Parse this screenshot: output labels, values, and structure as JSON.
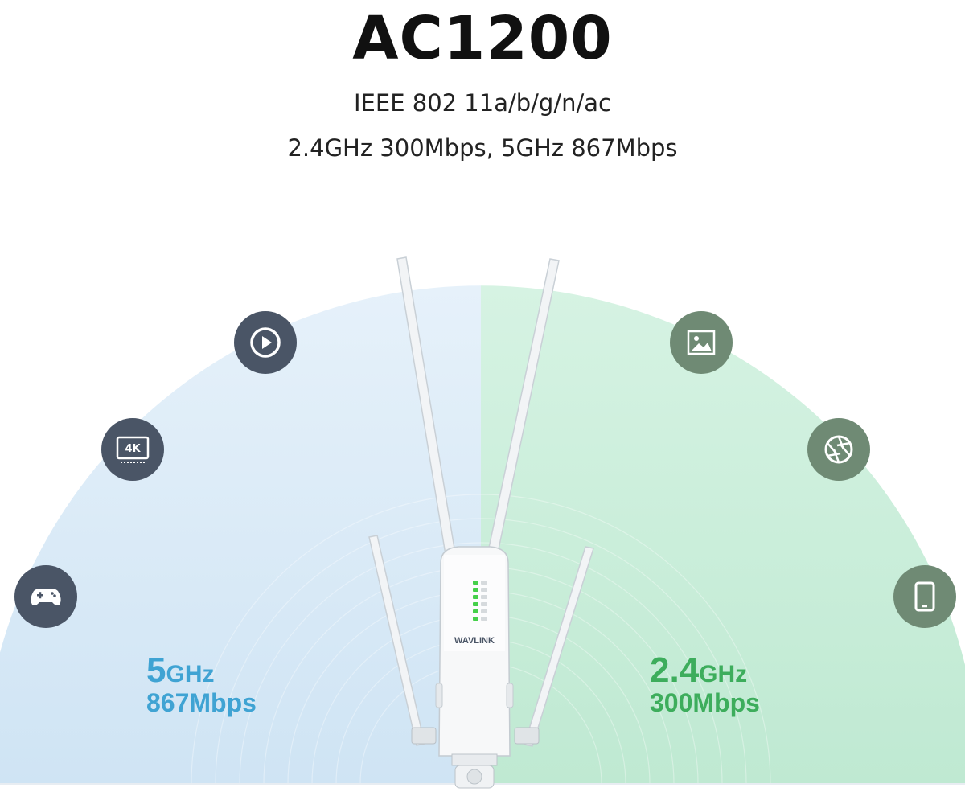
{
  "header": {
    "title": "AC1200",
    "subtitle_line1": "IEEE 802 11a/b/g/n/ac",
    "subtitle_line2": "2.4GHz 300Mbps, 5GHz 867Mbps"
  },
  "device": {
    "brand_label": "WAVLINK"
  },
  "bands": {
    "left": {
      "freq_number": "5",
      "freq_unit": "GHz",
      "rate": "867Mbps",
      "color": "#3fa3d3"
    },
    "right": {
      "freq_number": "2.4",
      "freq_unit": "GHz",
      "rate": "300Mbps",
      "color": "#3dad5c"
    }
  },
  "icons": {
    "left": [
      "gamepad-icon",
      "4k-monitor-icon",
      "play-icon"
    ],
    "right": [
      "image-icon",
      "aperture-icon",
      "tablet-icon"
    ],
    "monitor_label": "4K"
  },
  "colors": {
    "left_fan": "#d4e6f5",
    "right_fan": "#c6ecd7",
    "left_icon_bg": "#4a5566",
    "right_icon_bg": "#6f8a74"
  }
}
